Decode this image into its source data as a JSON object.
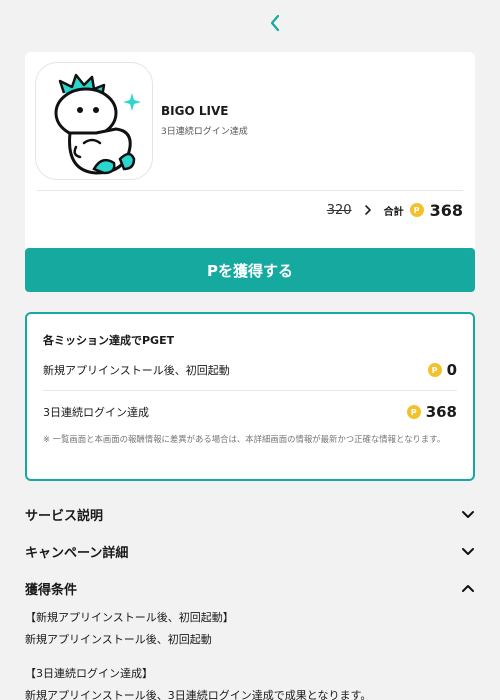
{
  "header": {
    "back_icon": "chevron-left-icon",
    "accent_color": "#16a9a0"
  },
  "app": {
    "name": "BIGO LIVE",
    "subtitle": "3日連続ログイン達成",
    "icon": "bigo-mascot-icon"
  },
  "price": {
    "old": "320",
    "total_label": "合計",
    "coin_symbol": "P",
    "total": "368"
  },
  "cta": {
    "label": "Pを獲得する"
  },
  "missions": {
    "title": "各ミッション達成でPGET",
    "items": [
      {
        "label": "新規アプリインストール後、初回起動",
        "points": "0"
      },
      {
        "label": "3日連続ログイン達成",
        "points": "368"
      }
    ],
    "note": "※ 一覧画面と本画面の報酬情報に差異がある場合は、本詳細画面の情報が最新かつ正確な情報となります。"
  },
  "sections": [
    {
      "title": "サービス説明",
      "expanded": false
    },
    {
      "title": "キャンペーン詳細",
      "expanded": false
    },
    {
      "title": "獲得条件",
      "expanded": true
    }
  ],
  "conditions": [
    {
      "heading": "【新規アプリインストール後、初回起動】",
      "text": "新規アプリインストール後、初回起動"
    },
    {
      "heading": "【3日連続ログイン達成】",
      "text": "新規アプリインストール後、3日連続ログイン達成で成果となります。"
    }
  ]
}
